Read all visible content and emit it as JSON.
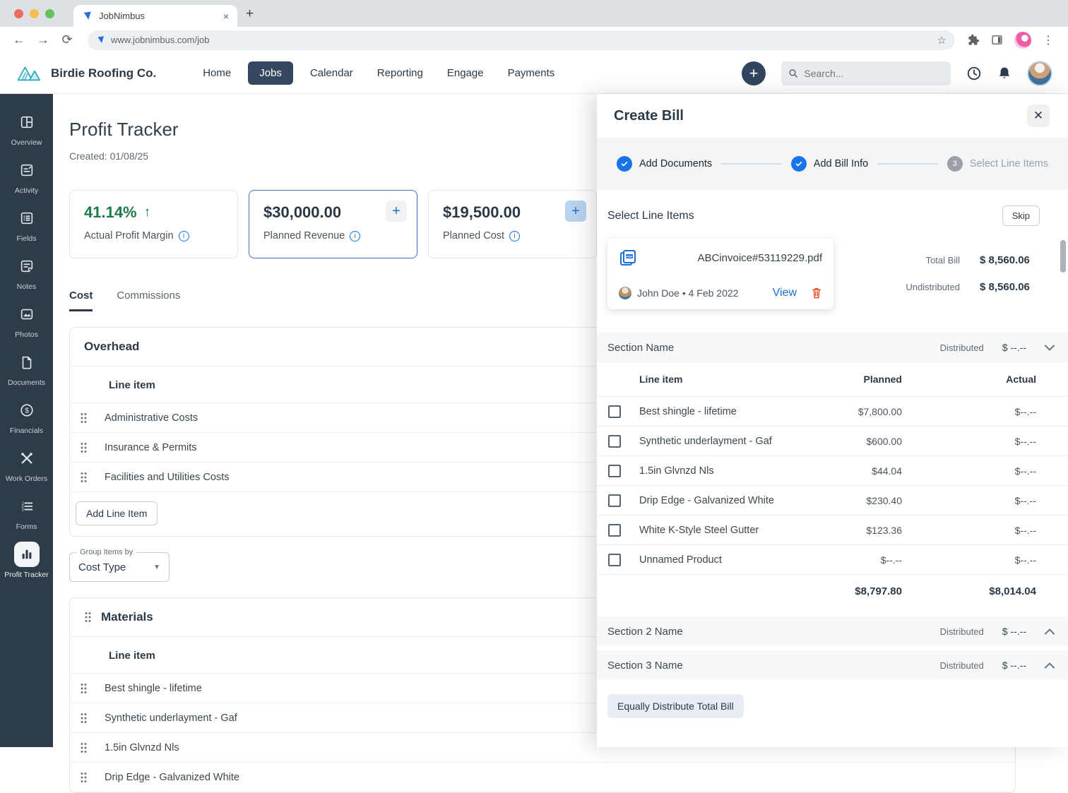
{
  "colors": {
    "accent_blue": "#1a6fd4",
    "brand_navy": "#31465e",
    "sidebar_navy": "#2e3c49",
    "success_green": "#1d7c4b",
    "danger_orange": "#e2582c",
    "step_done_blue": "#1a73e8"
  },
  "browser": {
    "tab_title": "JobNimbus",
    "url": "www.jobnimbus.com/job",
    "close_glyph": "×",
    "new_tab_glyph": "+",
    "back_glyph": "←",
    "forward_glyph": "→",
    "reload_glyph": "⟳",
    "star_glyph": "☆",
    "kebab_glyph": "⋮"
  },
  "header": {
    "company": "Birdie Roofing Co.",
    "nav": [
      {
        "label": "Home"
      },
      {
        "label": "Jobs",
        "active": true
      },
      {
        "label": "Calendar"
      },
      {
        "label": "Reporting"
      },
      {
        "label": "Engage"
      },
      {
        "label": "Payments"
      }
    ],
    "add_glyph": "+",
    "search_placeholder": "Search..."
  },
  "sidebar": {
    "items": [
      {
        "label": "Overview",
        "icon": "overview-icon"
      },
      {
        "label": "Activity",
        "icon": "activity-icon"
      },
      {
        "label": "Fields",
        "icon": "fields-icon"
      },
      {
        "label": "Notes",
        "icon": "notes-icon"
      },
      {
        "label": "Photos",
        "icon": "photos-icon"
      },
      {
        "label": "Documents",
        "icon": "documents-icon"
      },
      {
        "label": "Financials",
        "icon": "financials-icon"
      },
      {
        "label": "Work Orders",
        "icon": "work-orders-icon"
      },
      {
        "label": "Forms",
        "icon": "forms-icon"
      },
      {
        "label": "Profit Tracker",
        "icon": "profit-tracker-icon",
        "active": true
      }
    ]
  },
  "main": {
    "title": "Profit Tracker",
    "created": "Created: 01/08/25",
    "stats": [
      {
        "value": "41.14%",
        "label": "Actual Profit Margin",
        "trend": "up"
      },
      {
        "value": "$30,000.00",
        "label": "Planned Revenue"
      },
      {
        "value": "$19,500.00",
        "label": "Planned Cost"
      }
    ],
    "tabs": [
      {
        "label": "Cost",
        "active": true
      },
      {
        "label": "Commissions"
      }
    ],
    "overhead": {
      "title": "Overhead",
      "column": "Line item",
      "rows": [
        "Administrative Costs",
        "Insurance & Permits",
        "Facilities and Utilities Costs"
      ],
      "add_button": "Add Line Item"
    },
    "group_by": {
      "label": "Group Items by",
      "value": "Cost Type"
    },
    "materials": {
      "title": "Materials",
      "column": "Line item",
      "rows": [
        "Best shingle - lifetime",
        "Synthetic underlayment - Gaf",
        "1.5in Glvnzd Nls",
        "Drip Edge - Galvanized White"
      ]
    }
  },
  "drawer": {
    "title": "Create Bill",
    "close_glyph": "✕",
    "steps": [
      {
        "label": "Add Documents",
        "state": "done"
      },
      {
        "label": "Add Bill Info",
        "state": "done"
      },
      {
        "label": "Select Line Items",
        "number": "3",
        "state": "upcoming"
      }
    ],
    "section_title": "Select Line Items",
    "skip_button": "Skip",
    "file": {
      "name": "ABCinvoice#53119229.pdf",
      "meta": "John Doe • 4 Feb 2022",
      "view_link": "View"
    },
    "totals": {
      "total_bill_label": "Total Bill",
      "total_bill": "$ 8,560.06",
      "undistributed_label": "Undistributed",
      "undistributed": "$ 8,560.06"
    },
    "sections": [
      {
        "name": "Section Name",
        "distributed_label": "Distributed",
        "amount": "$ --.--",
        "expanded": true
      },
      {
        "name": "Section 2 Name",
        "distributed_label": "Distributed",
        "amount": "$ --.--",
        "expanded": false
      },
      {
        "name": "Section 3 Name",
        "distributed_label": "Distributed",
        "amount": "$ --.--",
        "expanded": false
      }
    ],
    "line_items": {
      "headers": {
        "item": "Line item",
        "planned": "Planned",
        "actual": "Actual"
      },
      "rows": [
        {
          "item": "Best shingle - lifetime",
          "planned": "$7,800.00",
          "actual": "$--.--"
        },
        {
          "item": "Synthetic underlayment - Gaf",
          "planned": "$600.00",
          "actual": "$--.--"
        },
        {
          "item": "1.5in Glvnzd Nls",
          "planned": "$44.04",
          "actual": "$--.--"
        },
        {
          "item": "Drip Edge - Galvanized White",
          "planned": "$230.40",
          "actual": "$--.--"
        },
        {
          "item": "White K-Style Steel Gutter",
          "planned": "$123.36",
          "actual": "$--.--"
        },
        {
          "item": "Unnamed Product",
          "planned": "$--.--",
          "actual": "$--.--"
        }
      ],
      "totals": {
        "planned": "$8,797.80",
        "actual": "$8,014.04"
      }
    },
    "distribute_button": "Equally Distribute Total Bill"
  }
}
